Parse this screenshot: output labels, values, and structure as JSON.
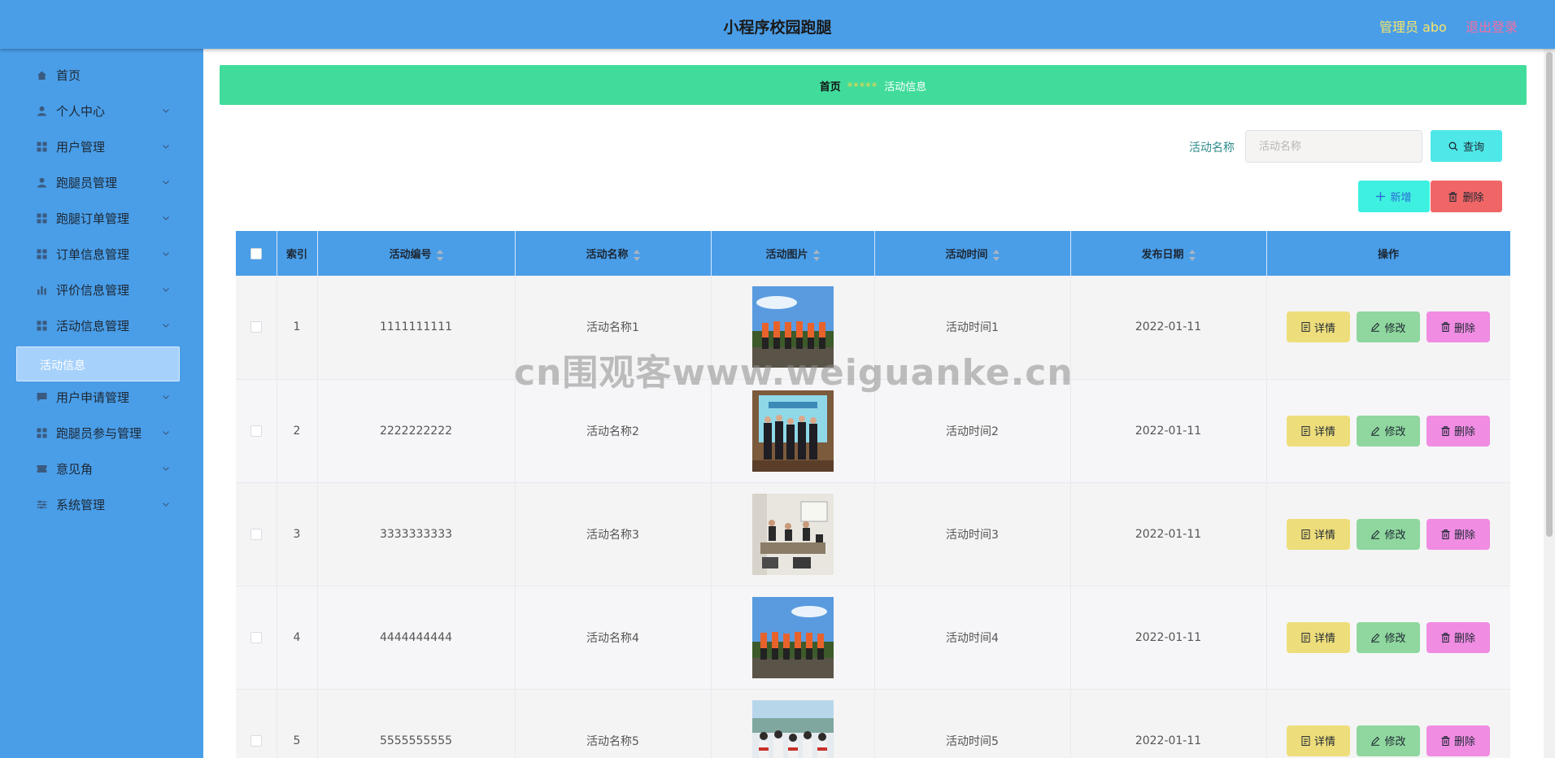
{
  "header": {
    "title": "小程序校园跑腿",
    "admin_label": "管理员 abo",
    "logout_label": "退出登录"
  },
  "sidebar": {
    "items": [
      {
        "label": "首页",
        "icon": "home-icon",
        "expandable": false
      },
      {
        "label": "个人中心",
        "icon": "user-icon",
        "expandable": true
      },
      {
        "label": "用户管理",
        "icon": "grid-icon",
        "expandable": true
      },
      {
        "label": "跑腿员管理",
        "icon": "user-icon",
        "expandable": true
      },
      {
        "label": "跑腿订单管理",
        "icon": "grid-icon",
        "expandable": true
      },
      {
        "label": "订单信息管理",
        "icon": "grid-icon",
        "expandable": true
      },
      {
        "label": "评价信息管理",
        "icon": "bar-chart-icon",
        "expandable": true
      },
      {
        "label": "活动信息管理",
        "icon": "grid-icon",
        "expandable": true
      },
      {
        "label": "用户申请管理",
        "icon": "message-icon",
        "expandable": true
      },
      {
        "label": "跑腿员参与管理",
        "icon": "grid-icon",
        "expandable": true
      },
      {
        "label": "意见角",
        "icon": "ticket-icon",
        "expandable": true
      },
      {
        "label": "系统管理",
        "icon": "sliders-icon",
        "expandable": true
      }
    ],
    "active_submenu": "活动信息"
  },
  "breadcrumb": {
    "home": "首页",
    "separator": "*****",
    "current": "活动信息"
  },
  "search": {
    "label": "活动名称",
    "placeholder": "活动名称",
    "value": "",
    "query_label": "查询"
  },
  "toolbar": {
    "add_label": "新增",
    "delete_label": "删除"
  },
  "table": {
    "columns": [
      "索引",
      "活动编号",
      "活动名称",
      "活动图片",
      "活动时间",
      "发布日期",
      "操作"
    ],
    "rows": [
      {
        "index": "1",
        "code": "1111111111",
        "name": "活动名称1",
        "time": "活动时间1",
        "date": "2022-01-11"
      },
      {
        "index": "2",
        "code": "2222222222",
        "name": "活动名称2",
        "time": "活动时间2",
        "date": "2022-01-11"
      },
      {
        "index": "3",
        "code": "3333333333",
        "name": "活动名称3",
        "time": "活动时间3",
        "date": "2022-01-11"
      },
      {
        "index": "4",
        "code": "4444444444",
        "name": "活动名称4",
        "time": "活动时间4",
        "date": "2022-01-11"
      },
      {
        "index": "5",
        "code": "5555555555",
        "name": "活动名称5",
        "time": "活动时间5",
        "date": "2022-01-11"
      }
    ],
    "actions": {
      "detail": "详情",
      "edit": "修改",
      "delete": "删除"
    }
  },
  "watermark": "cn围观客www.weiguanke.cn"
}
